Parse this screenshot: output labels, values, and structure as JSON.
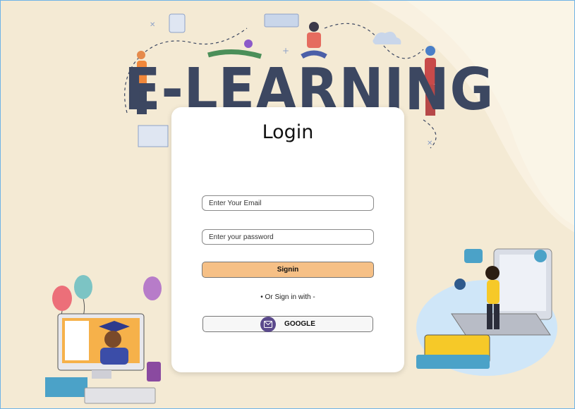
{
  "hero": {
    "title": "E-LEARNING"
  },
  "login": {
    "title": "Login",
    "email_placeholder": "Enter Your Email",
    "password_placeholder": "Enter your password",
    "signin_label": "Signin",
    "divider_text": "• Or Sign in with -",
    "google_label": "GOOGLE",
    "google_icon": "mail-icon"
  },
  "colors": {
    "background": "#f4ead4",
    "signin_button": "#f6c086",
    "google_icon_bg": "#5b4a8c",
    "hero_text": "#3c4761"
  }
}
